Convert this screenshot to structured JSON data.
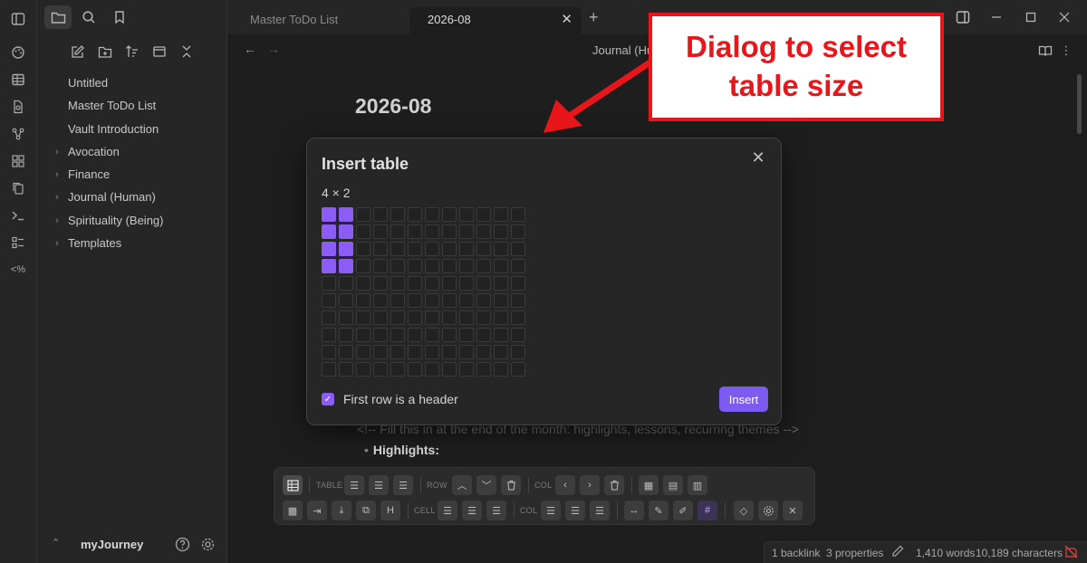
{
  "sidebar": {
    "files": [
      {
        "label": "Untitled",
        "folder": false
      },
      {
        "label": "Master ToDo List",
        "folder": false
      },
      {
        "label": "Vault Introduction",
        "folder": false
      },
      {
        "label": "Avocation",
        "folder": true
      },
      {
        "label": "Finance",
        "folder": true
      },
      {
        "label": "Journal (Human)",
        "folder": true
      },
      {
        "label": "Spirituality (Being)",
        "folder": true
      },
      {
        "label": "Templates",
        "folder": true
      }
    ],
    "vault_name": "myJourney"
  },
  "tabs": [
    {
      "label": "Master ToDo List"
    },
    {
      "label": "2026-08"
    }
  ],
  "editor": {
    "breadcrumb": "Journal (Hu",
    "title": "2026-08",
    "comment": "<!-- Fill this in at the end of the month: highlights, lessons, recurring themes -->",
    "bullet": "Highlights:"
  },
  "modal": {
    "title": "Insert table",
    "size_label": "4 × 2",
    "selected_rows": 4,
    "selected_cols": 2,
    "grid_rows": 10,
    "grid_cols": 12,
    "header_checkbox_label": "First row is a header",
    "header_checked": true,
    "insert_label": "Insert"
  },
  "toolbar": {
    "table_label": "TABLE",
    "row_label": "ROW",
    "col_label": "COL",
    "cell_label": "CELL",
    "col2_label": "COL",
    "hash_label": "#"
  },
  "status": {
    "backlinks": "1 backlink",
    "properties": "3 properties",
    "words": "1,410 words",
    "characters": "10,189 characters"
  },
  "annotation": {
    "text": "Dialog to select table size"
  },
  "colors": {
    "accent": "#8b5cf6",
    "annotation_red": "#e8151b"
  }
}
